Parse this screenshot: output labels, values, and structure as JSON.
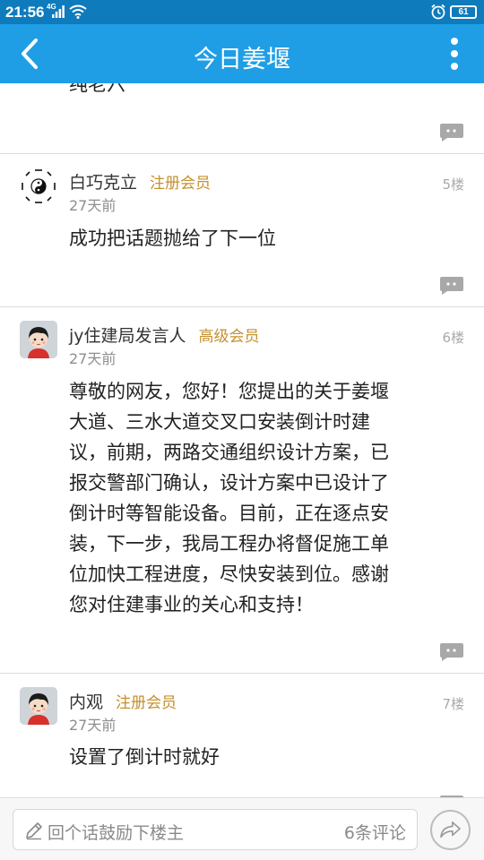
{
  "status": {
    "time": "21:56",
    "net": "4G",
    "battery": "61"
  },
  "appbar": {
    "title": "今日姜堰"
  },
  "posts": [
    {
      "text": "纯老六"
    },
    {
      "username": "白巧克立",
      "badge": "注册会员",
      "time": "27天前",
      "floor": "5楼",
      "text": "成功把话题抛给了下一位"
    },
    {
      "username": "jy住建局发言人",
      "badge": "高级会员",
      "time": "27天前",
      "floor": "6楼",
      "text_lines": [
        "尊敬的网友，您好！您提出的关于姜堰",
        "大道、三水大道交叉口安装倒计时建",
        "议，前期，两路交通组织设计方案，已",
        "报交警部门确认，设计方案中已设计了",
        "倒计时等智能设备。目前，正在逐点安",
        "装，下一步，我局工程办将督促施工单",
        "位加快工程进度，尽快安装到位。感谢",
        "您对住建事业的关心和支持！"
      ]
    },
    {
      "username": "内观",
      "badge": "注册会员",
      "time": "27天前",
      "floor": "7楼",
      "text": "设置了倒计时就好"
    }
  ],
  "bottom": {
    "placeholder": "回个话鼓励下楼主",
    "comment_count": "6条评论"
  },
  "colors": {
    "statusbar": "#0e7bbd",
    "appbar": "#1f9ee6",
    "badge": "#c4902e"
  }
}
